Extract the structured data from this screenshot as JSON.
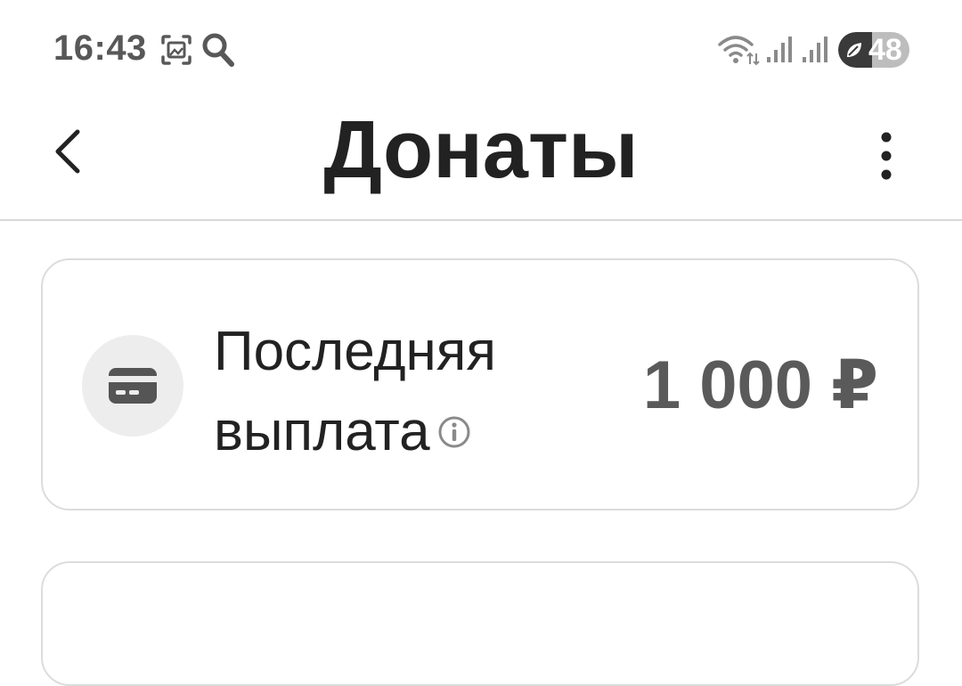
{
  "status_bar": {
    "time": "16:43",
    "icons": [
      "screenshot-icon",
      "search-icon",
      "wifi-icon",
      "signal-icon",
      "signal-icon"
    ],
    "battery_level": "48"
  },
  "header": {
    "title": "Донаты",
    "back_icon": "chevron-left-icon",
    "menu_icon": "more-vertical-icon"
  },
  "last_payout": {
    "label": "Последняя выплата",
    "amount": "1 000 ₽",
    "icon": "card-icon",
    "info_icon": "info-icon"
  },
  "colors": {
    "text_primary": "#222222",
    "text_secondary": "#5a5a5a",
    "border": "#dcdcdc",
    "icon_bg": "#ededed"
  }
}
